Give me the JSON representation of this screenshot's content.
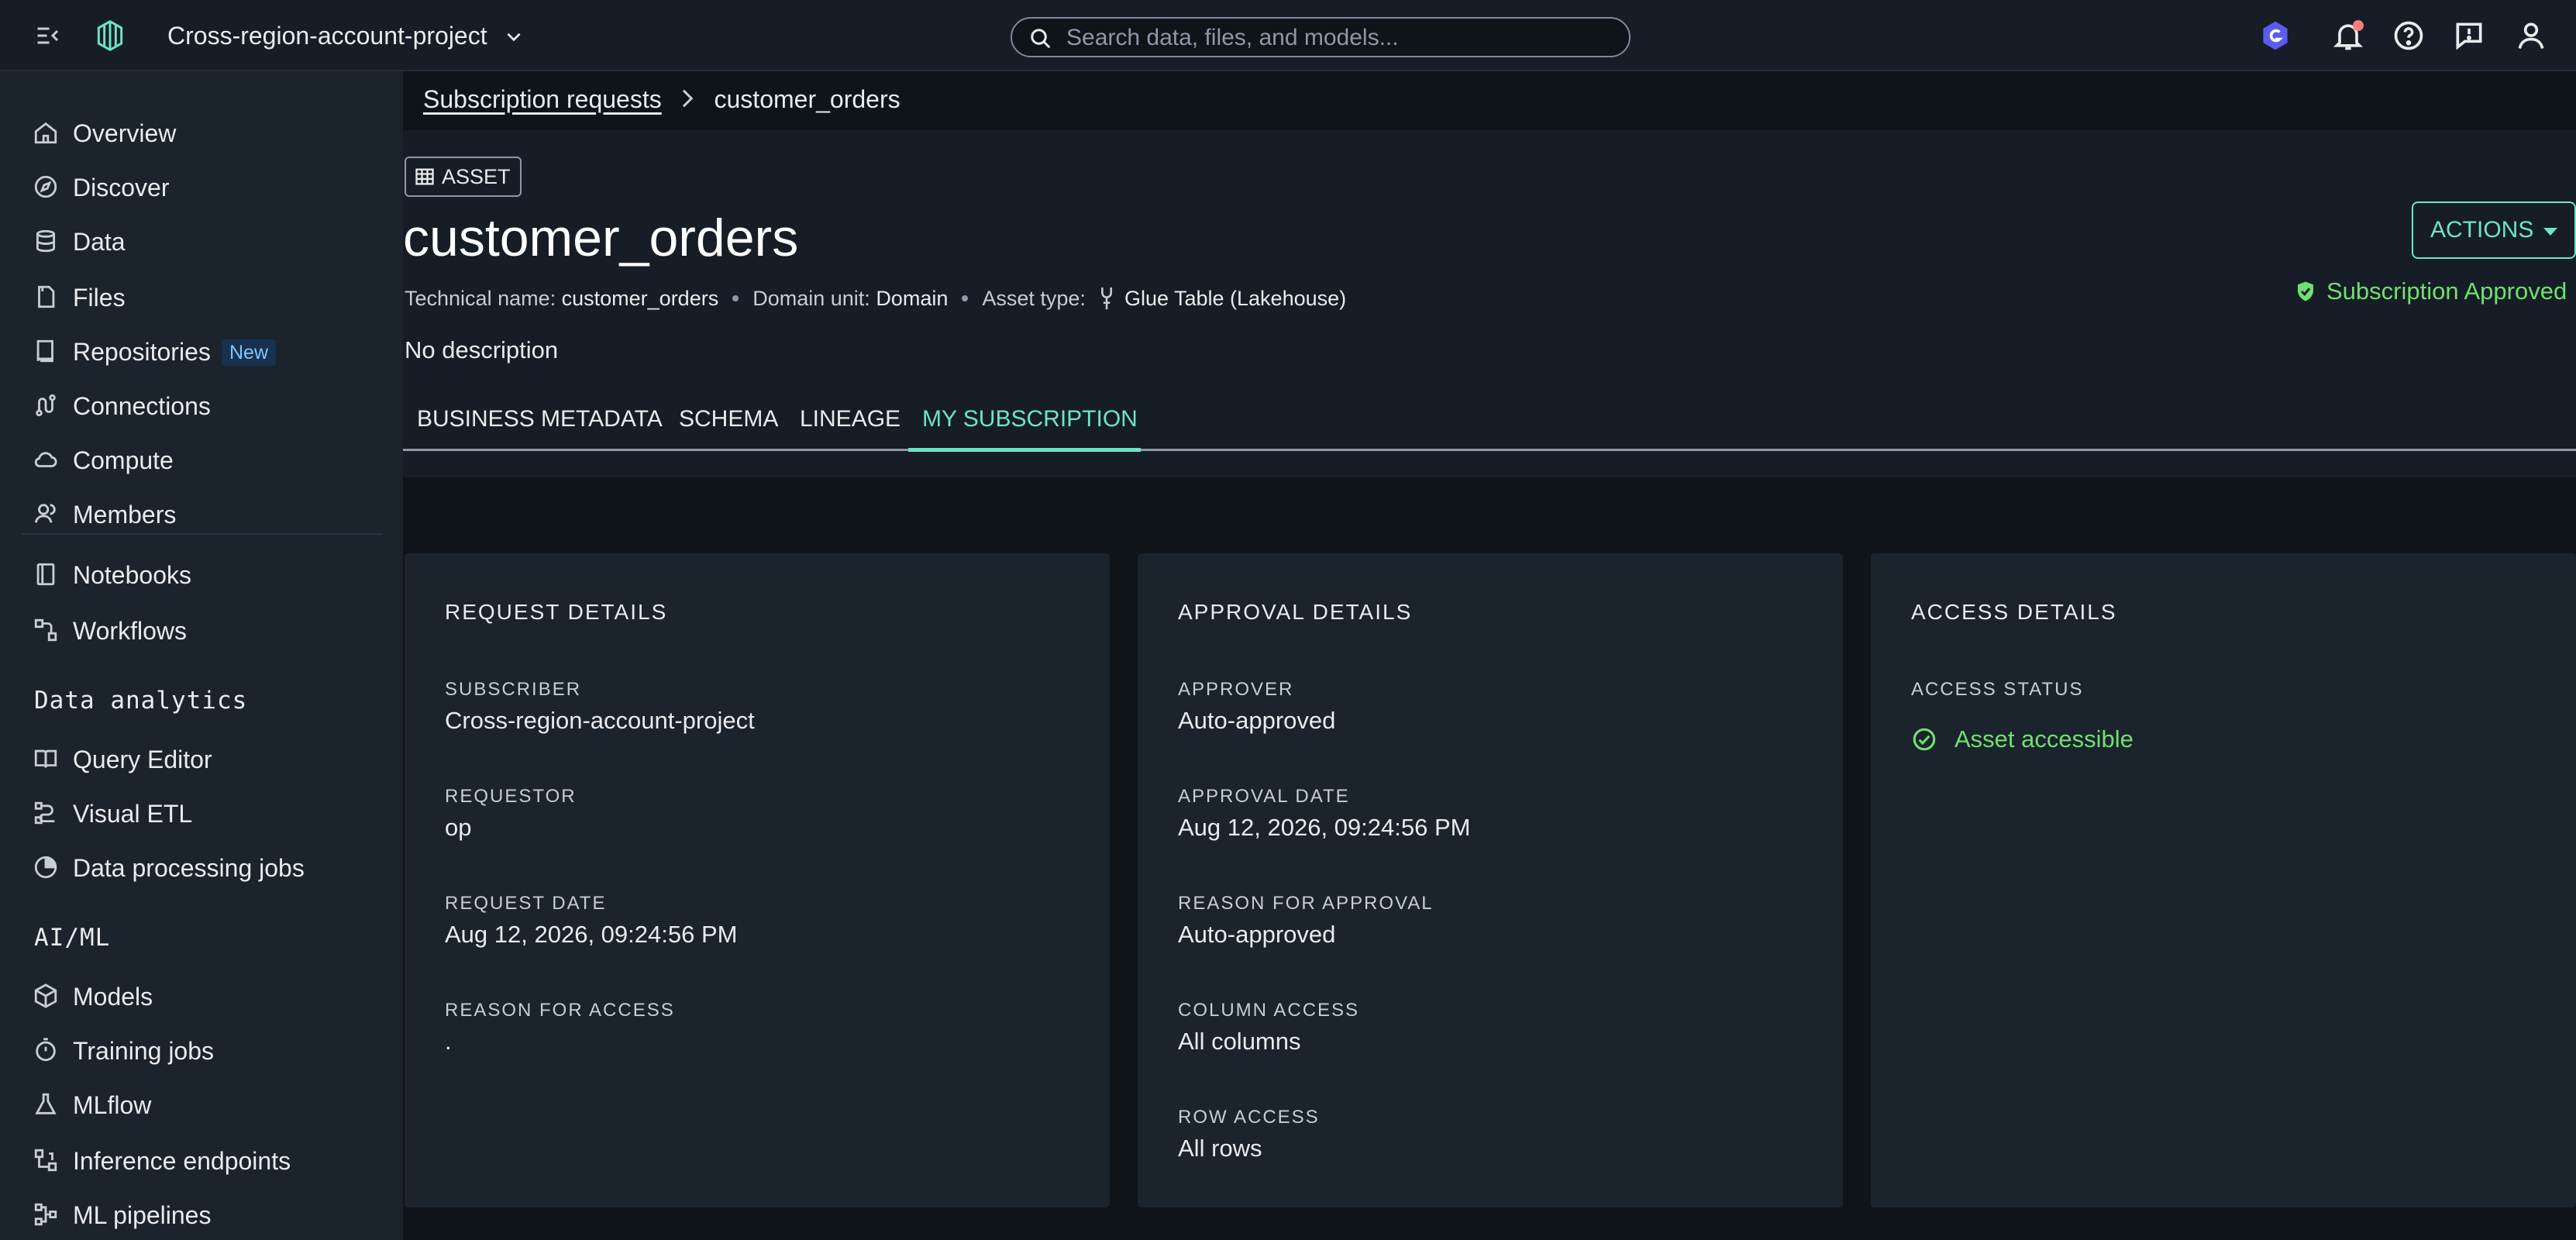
{
  "topbar": {
    "project_name": "Cross-region-account-project",
    "search_placeholder": "Search data, files, and models..."
  },
  "sidebar": {
    "items_main": [
      {
        "label": "Overview",
        "icon": "home-icon"
      },
      {
        "label": "Discover",
        "icon": "compass-icon"
      },
      {
        "label": "Data",
        "icon": "database-icon"
      },
      {
        "label": "Files",
        "icon": "file-icon"
      },
      {
        "label": "Repositories",
        "icon": "book-icon",
        "badge": "New"
      },
      {
        "label": "Connections",
        "icon": "plug-icon"
      },
      {
        "label": "Compute",
        "icon": "cloud-icon"
      },
      {
        "label": "Members",
        "icon": "users-icon"
      }
    ],
    "items_tools": [
      {
        "label": "Notebooks",
        "icon": "notebook-icon"
      },
      {
        "label": "Workflows",
        "icon": "workflow-icon"
      }
    ],
    "section_analytics": "Data analytics",
    "items_analytics": [
      {
        "label": "Query Editor",
        "icon": "book-open-icon"
      },
      {
        "label": "Visual ETL",
        "icon": "etl-icon"
      },
      {
        "label": "Data processing jobs",
        "icon": "pie-icon"
      }
    ],
    "section_aiml": "AI/ML",
    "items_aiml": [
      {
        "label": "Models",
        "icon": "cube-icon"
      },
      {
        "label": "Training jobs",
        "icon": "stopwatch-icon"
      },
      {
        "label": "MLflow",
        "icon": "flask-icon"
      },
      {
        "label": "Inference endpoints",
        "icon": "endpoint-icon"
      },
      {
        "label": "ML pipelines",
        "icon": "pipeline-icon"
      }
    ]
  },
  "breadcrumb": {
    "parent": "Subscription requests",
    "current": "customer_orders"
  },
  "asset": {
    "tag": "ASSET",
    "title": "customer_orders",
    "technical_name_label": "Technical name:",
    "technical_name": "customer_orders",
    "domain_unit_label": "Domain unit:",
    "domain_unit": "Domain",
    "asset_type_label": "Asset type:",
    "asset_type": "Glue Table (Lakehouse)",
    "description": "No description",
    "actions_label": "ACTIONS",
    "subscription_status": "Subscription Approved"
  },
  "tabs": [
    "BUSINESS METADATA",
    "SCHEMA",
    "LINEAGE",
    "MY SUBSCRIPTION"
  ],
  "request_details": {
    "title": "REQUEST DETAILS",
    "subscriber_label": "SUBSCRIBER",
    "subscriber": "Cross-region-account-project",
    "requestor_label": "REQUESTOR",
    "requestor": "op",
    "request_date_label": "REQUEST DATE",
    "request_date": "Aug 12, 2026, 09:24:56 PM",
    "reason_label": "REASON FOR ACCESS",
    "reason": "."
  },
  "approval_details": {
    "title": "APPROVAL DETAILS",
    "approver_label": "APPROVER",
    "approver": "Auto-approved",
    "approval_date_label": "APPROVAL DATE",
    "approval_date": "Aug 12, 2026, 09:24:56 PM",
    "reason_label": "REASON FOR APPROVAL",
    "reason": "Auto-approved",
    "column_access_label": "COLUMN ACCESS",
    "column_access": "All columns",
    "row_access_label": "ROW ACCESS",
    "row_access": "All rows"
  },
  "access_details": {
    "title": "ACCESS DETAILS",
    "status_label": "ACCESS STATUS",
    "status": "Asset accessible"
  },
  "colors": {
    "accent": "#6fe3c8",
    "success": "#6fe06f",
    "background": "#0f141a",
    "panel": "#1b232d"
  }
}
